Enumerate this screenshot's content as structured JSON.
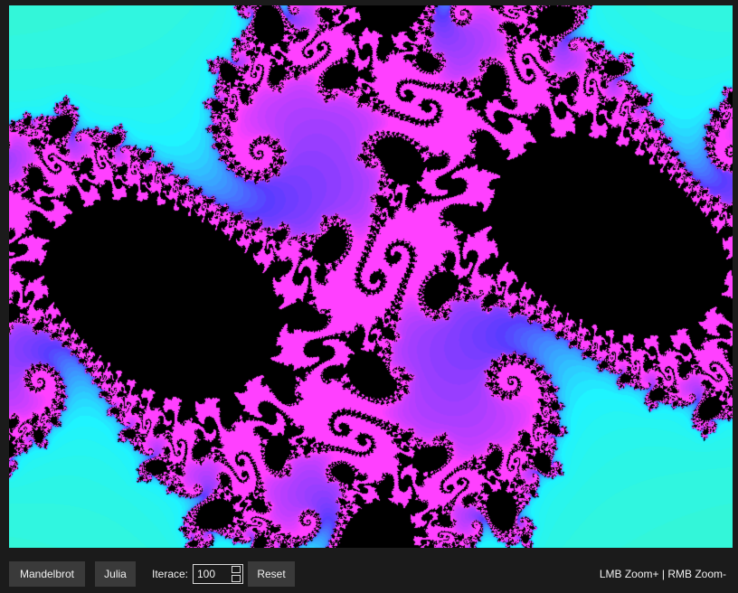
{
  "fractal": {
    "type": "Julia",
    "colors": {
      "interior": "#000000",
      "near": "#ff40ff",
      "mid": "#5a3cff",
      "far": "#1ff4ff",
      "outer": "#40f7c0"
    }
  },
  "toolbar": {
    "mandelbrot_label": "Mandelbrot",
    "julia_label": "Julia",
    "iterations_label": "Iterace:",
    "iterations_value": "100",
    "reset_label": "Reset",
    "hint": "LMB Zoom+ | RMB Zoom-"
  },
  "colors": {
    "background": "#1b1b1b",
    "button_bg": "#3a3a3a",
    "text": "#f0f0f0"
  }
}
